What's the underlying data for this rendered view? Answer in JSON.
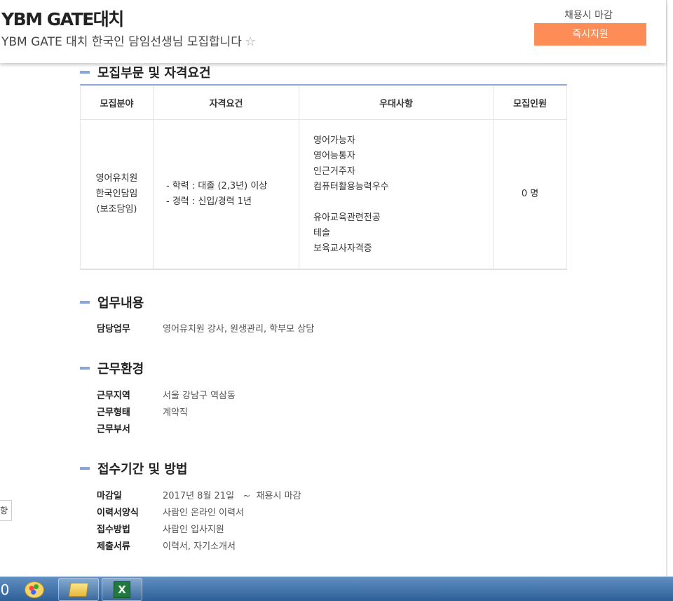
{
  "header": {
    "company": "YBM GATE대치",
    "subtitle": "YBM GATE 대치 한국인 담임선생님 모집합니다",
    "deadline": "채용시 마감",
    "apply_label": "즉시지원"
  },
  "requirements": {
    "title": "모집부문 및 자격요건",
    "columns": [
      "모집분야",
      "자격요건",
      "우대사항",
      "모집인원"
    ],
    "field": [
      "영어유치원",
      "한국인담임",
      "(보조담임)"
    ],
    "qualifications": [
      "- 학력 : 대졸 (2,3년) 이상",
      "- 경력 : 신입/경력 1년"
    ],
    "preferences_a": [
      "영어가능자",
      "영어능통자",
      "인근거주자",
      "컴퓨터활용능력우수"
    ],
    "preferences_b": [
      "유아교육관련전공",
      "테솔",
      "보육교사자격증"
    ],
    "headcount": "0 명"
  },
  "duties": {
    "title": "업무내용",
    "rows": [
      {
        "key": "담당업무",
        "value": "영어유치원 강사, 원생관리, 학부모 상담"
      }
    ]
  },
  "environment": {
    "title": "근무환경",
    "rows": [
      {
        "key": "근무지역",
        "value": "서울 강남구 역삼동"
      },
      {
        "key": "근무형태",
        "value": "계약직"
      },
      {
        "key": "근무부서",
        "value": ""
      }
    ]
  },
  "application": {
    "title": "접수기간 및 방법",
    "rows": [
      {
        "key": "마감일",
        "value": "2017년 8월 21일   ~  채용시 마감"
      },
      {
        "key": "이력서양식",
        "value": "사람인 온라인 이력서"
      },
      {
        "key": "접수방법",
        "value": "사람인 입사지원"
      },
      {
        "key": "제출서류",
        "value": "이력서, 자기소개서"
      }
    ]
  },
  "side_tab": "향",
  "taskbar": {
    "start_glyph": "0",
    "icons": [
      "paint-icon",
      "windows-explorer-icon",
      "excel-icon"
    ],
    "excel_glyph": "X"
  },
  "colors": {
    "accent_button": "#fe8c57",
    "section_bar": "#8aa5d8",
    "table_top_border": "#8fa9d4"
  }
}
